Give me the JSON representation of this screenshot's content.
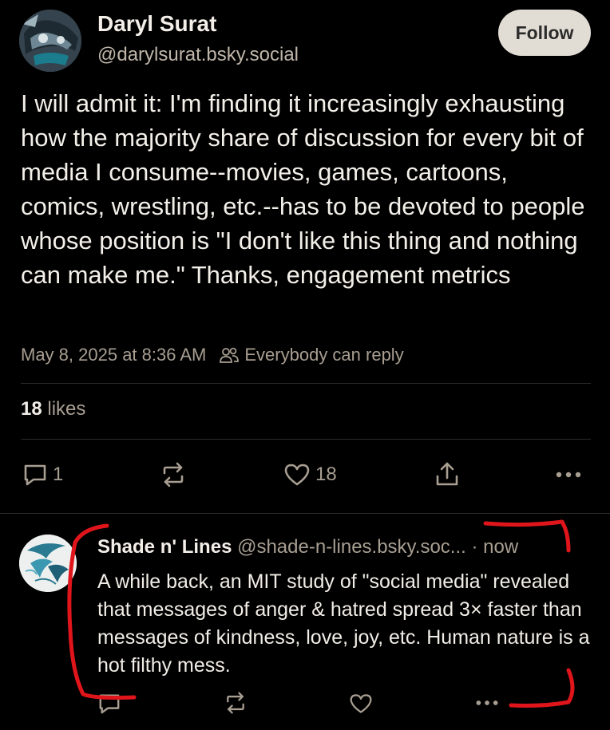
{
  "post": {
    "author_name": "Daryl Surat",
    "author_handle": "@darylsurat.bsky.social",
    "follow_label": "Follow",
    "text": "I will admit it: I'm finding it increasingly exhausting how the majority share of discussion for every bit of media I consume--movies, games, cartoons, comics, wrestling, etc.--has to be devoted to people whose position is \"I don't like this thing and nothing can make me.\" Thanks, engagement metrics",
    "timestamp": "May 8, 2025 at 8:36 AM",
    "reply_setting": "Everybody can reply",
    "likes_count": "18",
    "likes_label": "likes",
    "actions": {
      "reply_count": "1",
      "like_count": "18"
    }
  },
  "reply": {
    "author_name": "Shade n' Lines",
    "author_handle": "@shade-n-lines.bsky.soc...",
    "time": "· now",
    "text": "A while back, an MIT study of \"social media\" revealed that messages of anger & hatred spread 3× faster than messages of kindness, love, joy, etc. Human nature is a hot filthy mess."
  },
  "colors": {
    "background": "#000000",
    "text": "#f1ede6",
    "muted": "#a89e92",
    "follow_bg": "#e2ddd4",
    "annotation": "#e0151b"
  },
  "icons": [
    "reply-icon",
    "repost-icon",
    "like-icon",
    "share-icon",
    "more-icon",
    "people-icon"
  ]
}
